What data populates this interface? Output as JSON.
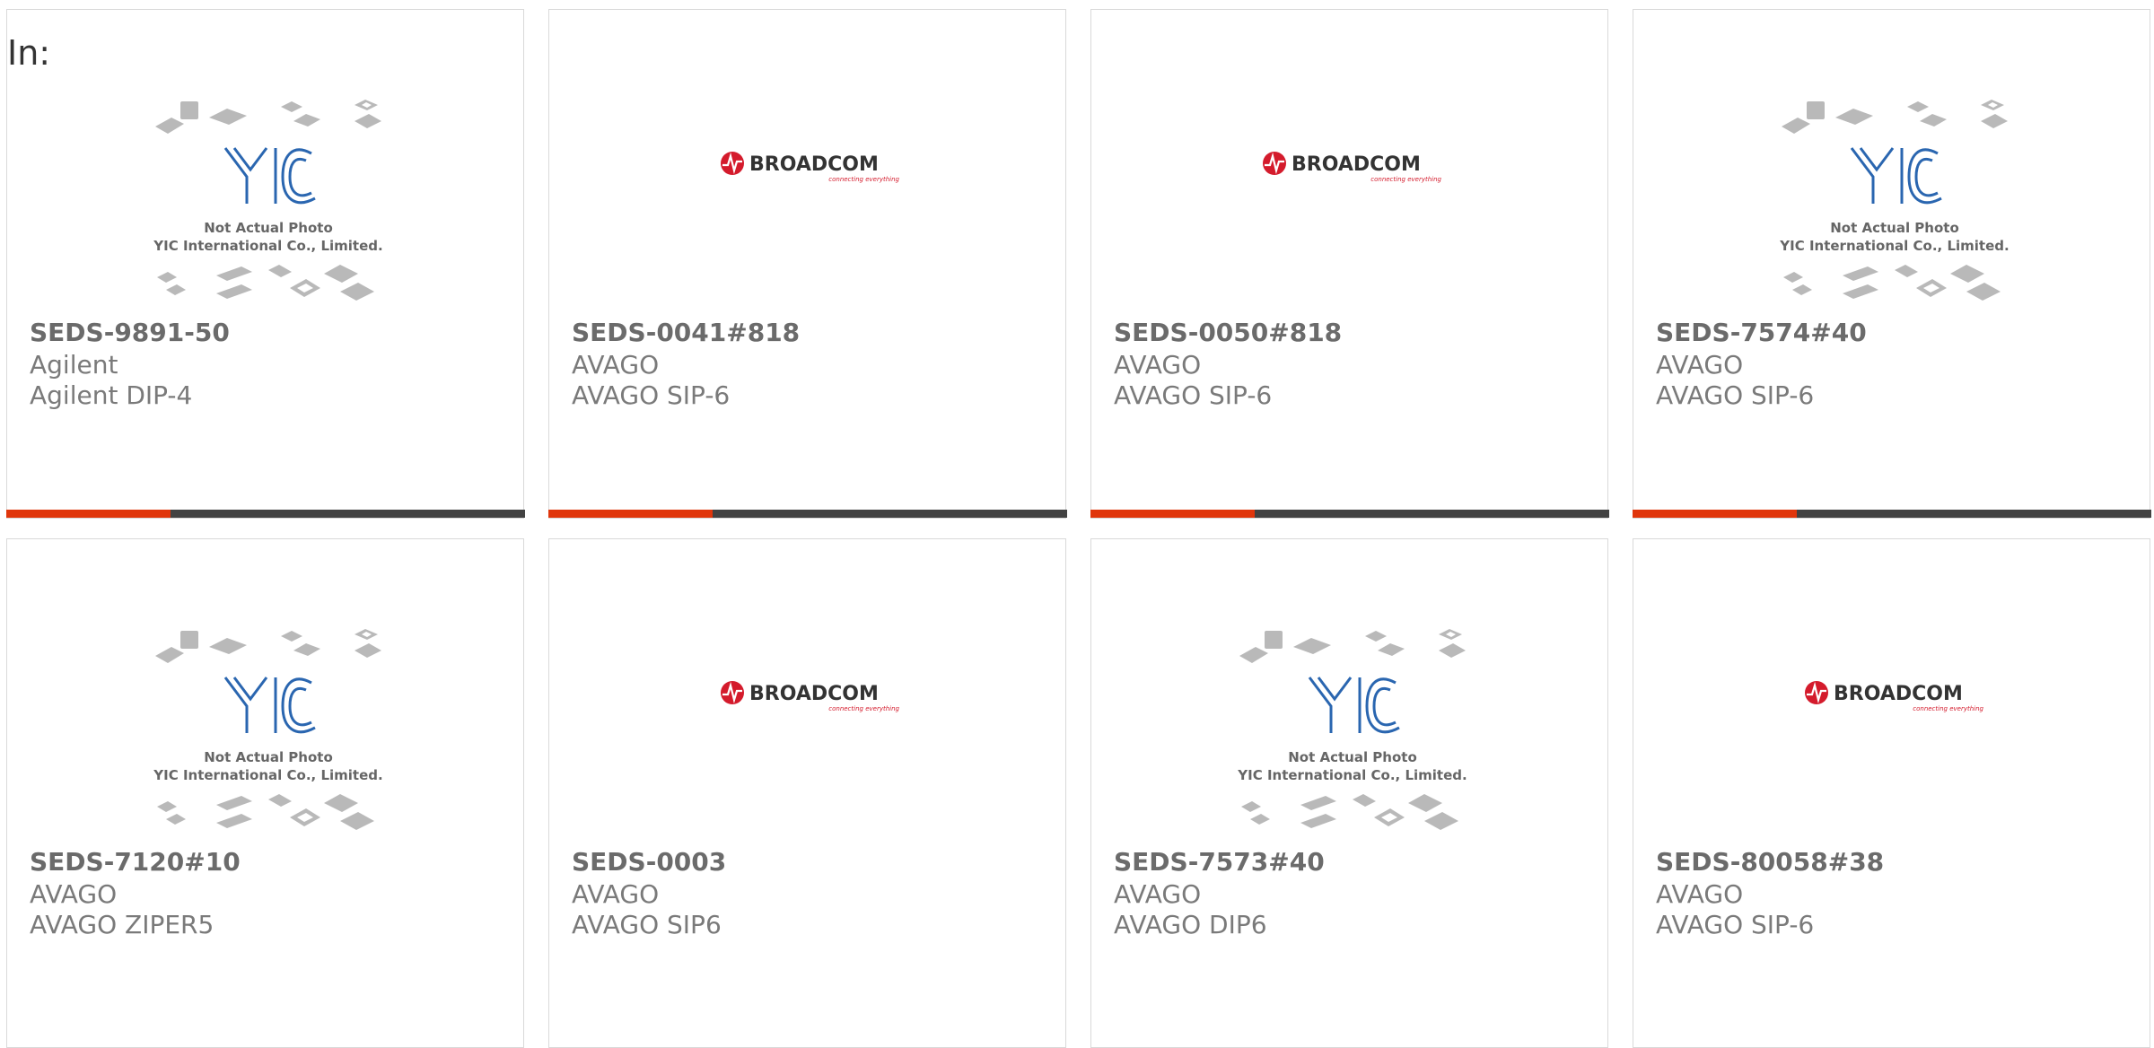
{
  "page": {
    "in_label": "In:"
  },
  "placeholder": {
    "line1": "Not Actual Photo",
    "line2": "YIC International Co., Limited.",
    "logo": "YIC"
  },
  "broadcom": {
    "name": "BROADCOM",
    "tagline": "connecting everything",
    "accent": "#d41b2c"
  },
  "colors": {
    "accent_bar": "#e0360c",
    "bar": "#424242"
  },
  "cards": [
    {
      "part": "SEDS-9891-50",
      "maker": "Agilent",
      "package": "Agilent DIP-4",
      "image": "yic-placeholder"
    },
    {
      "part": "SEDS-0041#818",
      "maker": "AVAGO",
      "package": "AVAGO SIP-6",
      "image": "broadcom-logo"
    },
    {
      "part": "SEDS-0050#818",
      "maker": "AVAGO",
      "package": "AVAGO SIP-6",
      "image": "broadcom-logo"
    },
    {
      "part": "SEDS-7574#40",
      "maker": "AVAGO",
      "package": "AVAGO SIP-6",
      "image": "yic-placeholder"
    },
    {
      "part": "SEDS-7120#10",
      "maker": "AVAGO",
      "package": "AVAGO ZIPER5",
      "image": "yic-placeholder"
    },
    {
      "part": "SEDS-0003",
      "maker": "AVAGO",
      "package": "AVAGO SIP6",
      "image": "broadcom-logo"
    },
    {
      "part": "SEDS-7573#40",
      "maker": "AVAGO",
      "package": "AVAGO DIP6",
      "image": "yic-placeholder"
    },
    {
      "part": "SEDS-80058#38",
      "maker": "AVAGO",
      "package": "AVAGO SIP-6",
      "image": "broadcom-logo"
    }
  ]
}
